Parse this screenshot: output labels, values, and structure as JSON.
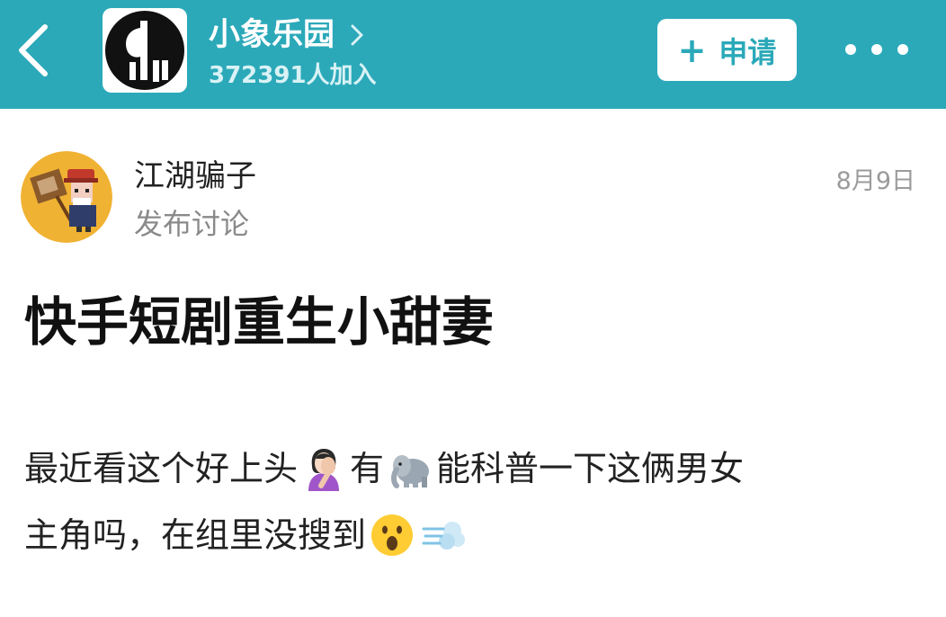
{
  "header": {
    "group_name": "小象乐园",
    "member_count": "372391人加入",
    "apply_label": "申请",
    "apply_icon": "plus-icon",
    "back_icon": "chevron-left-icon",
    "more_icon": "more-dots-icon",
    "background_color": "#2ba9b9"
  },
  "post": {
    "author": "江湖骗子",
    "action": "发布讨论",
    "date": "8月9日",
    "title": "快手短剧重生小甜妻",
    "body": {
      "line1_a": "最近看这个好上头",
      "line1_b": "有",
      "line1_c": "能科普一下这俩男女",
      "line2_a": "主角吗，在组里没搜到"
    },
    "emojis": [
      "woman-facepalming-emoji",
      "elephant-emoji",
      "surprised-face-emoji",
      "dash-emoji"
    ]
  }
}
